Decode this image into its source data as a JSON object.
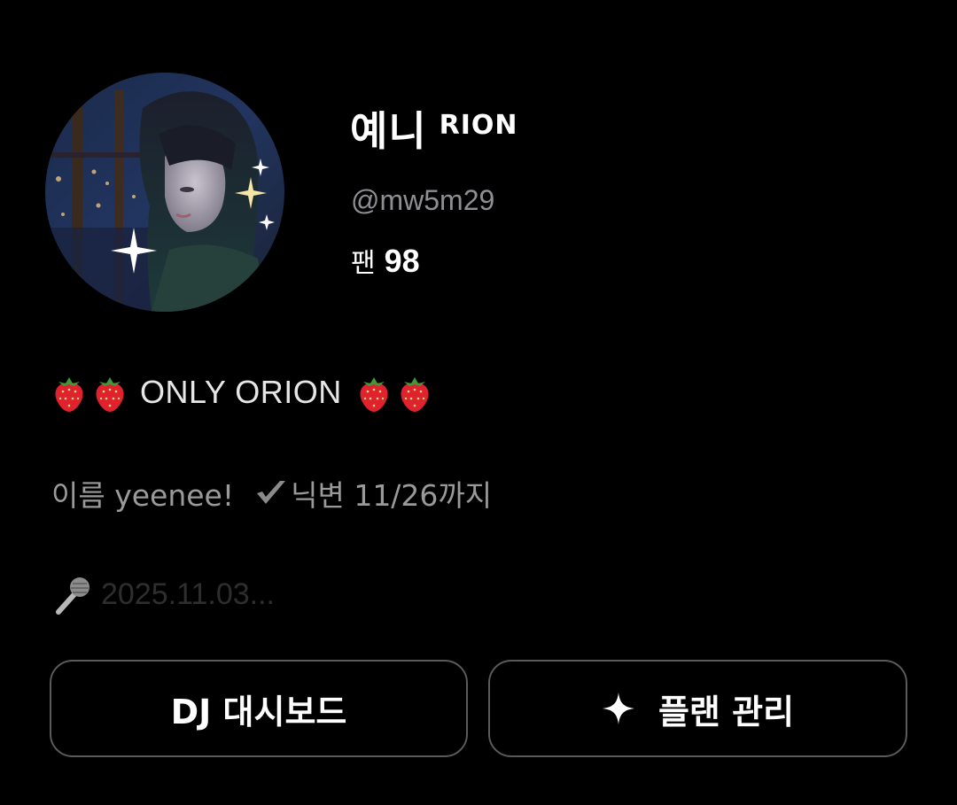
{
  "profile": {
    "display_name": "예니",
    "name_suffix": "RION",
    "handle": "@mw5m29",
    "fans_label": "팬",
    "fans_count": "98"
  },
  "bio": {
    "line1_text": "ONLY ORION",
    "line2_name": "이름 yeenee!",
    "line2_note": "닉변 11/26까지",
    "line3_text": "2025.11.03..."
  },
  "buttons": {
    "dashboard_label": "DJ 대시보드",
    "plan_label": "플랜 관리"
  },
  "icons": {
    "strawberry": "strawberry-emoji",
    "check": "heavy-check-mark",
    "mic": "microphone-emoji",
    "sparkle": "four-point-sparkle"
  },
  "colors": {
    "background": "#000000",
    "handle": "#8e8e93",
    "button_border": "#5a5a5a"
  }
}
